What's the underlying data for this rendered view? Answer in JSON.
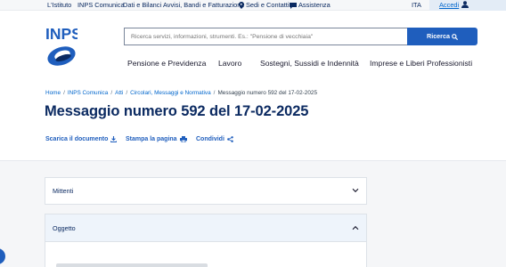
{
  "topbar": {
    "links": [
      "L'Istituto",
      "INPS Comunica",
      "Dati e Bilanci",
      "Avvisi, Bandi e Fatturazione"
    ],
    "sedi_label": "Sedi e Contatti",
    "assistenza_label": "Assistenza",
    "language": "ITA",
    "login_label": "Accedi"
  },
  "header": {
    "logo_text": "INPS",
    "search": {
      "placeholder": "Ricerca servizi, informazioni, strumenti. Es.: \"Pensione di vecchiaia\"",
      "button_label": "Ricerca"
    },
    "nav": [
      "Pensione e Previdenza",
      "Lavoro",
      "Sostegni, Sussidi e Indennità",
      "Imprese e Liberi Professionisti"
    ]
  },
  "breadcrumb": {
    "items": [
      "Home",
      "INPS Comunica",
      "Atti",
      "Circolari, Messaggi e Normativa"
    ],
    "current": "Messaggio numero 592 del 17-02-2025"
  },
  "page": {
    "title": "Messaggio numero 592 del 17-02-2025",
    "actions": {
      "download": "Scarica il documento",
      "print": "Stampa la pagina",
      "share": "Condividi"
    }
  },
  "sections": {
    "mittenti": "Mittenti",
    "oggetto": "Oggetto"
  },
  "colors": {
    "primary": "#1f5ebd",
    "dark_blue": "#0b2a61",
    "link": "#0066cc"
  }
}
